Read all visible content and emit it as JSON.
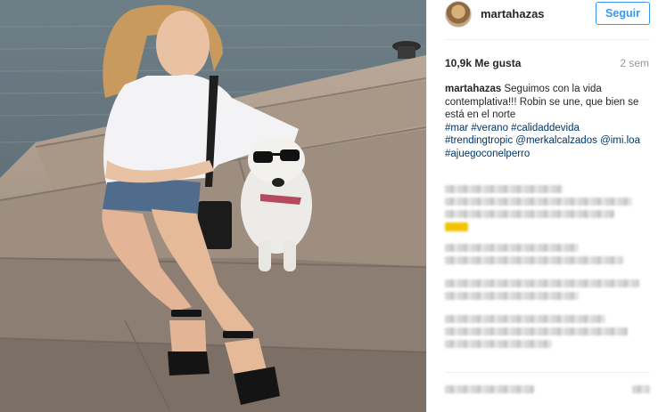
{
  "post": {
    "username": "martahazas",
    "follow_label": "Seguir",
    "likes": "10,9k Me gusta",
    "time_ago": "2 sem",
    "caption": {
      "user": "martahazas",
      "text": " Seguimos con la vida contemplativa!!! Robin se une, que bien se está en el norte",
      "tags": [
        "#mar",
        "#verano",
        "#calidaddevida",
        "#trendingtropic",
        "@merkalcalzados",
        "@imi.loa",
        "#ajuegoconelperro"
      ]
    }
  },
  "colors": {
    "accent": "#3897f0",
    "hashtag": "#003569",
    "meta": "#999999",
    "text": "#262626"
  },
  "icons": {
    "avatar": "profile-photo"
  }
}
